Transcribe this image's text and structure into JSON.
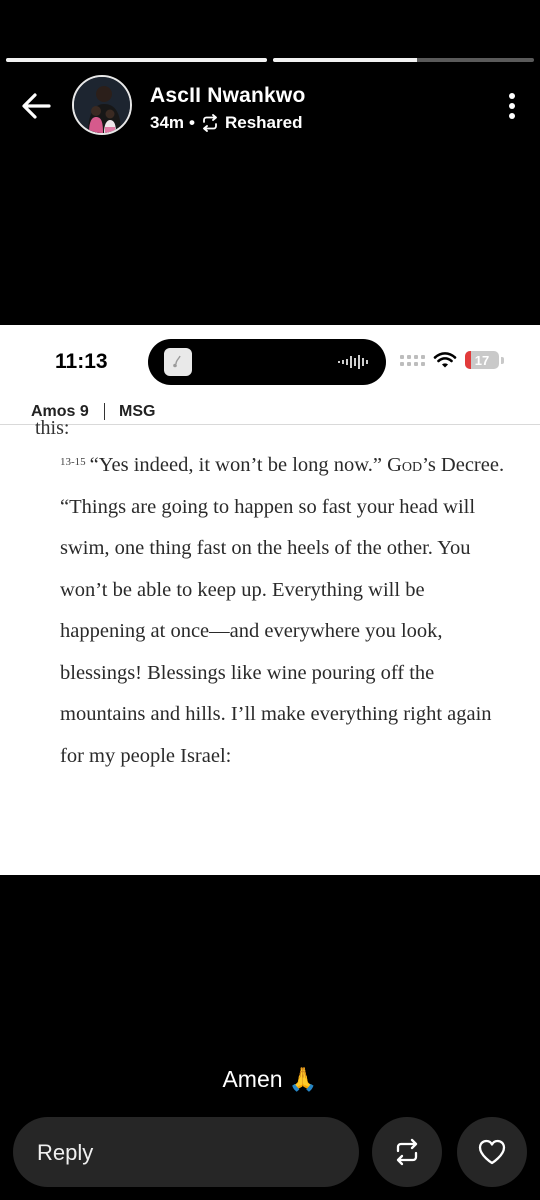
{
  "story": {
    "progress": [
      1.0,
      0.55
    ]
  },
  "header": {
    "author_name": "AscII Nwankwo",
    "time_ago": "34m",
    "dot": "•",
    "reshared_label": "Reshared",
    "back_icon": "arrow-left-icon",
    "more_icon": "more-vertical-icon",
    "reshare_icon": "repost-icon"
  },
  "screenshot": {
    "status_time": "11:13",
    "battery_level": "17",
    "battery_fraction": 0.17,
    "book": "Amos 9",
    "version": "MSG",
    "cut_line": "this:",
    "verse_number": "13-15",
    "line1": "“Yes indeed, it won’t be long now.” G",
    "line1_smallcaps": "od",
    "line1_end": "’s Decree.",
    "paragraph2": "“Things are going to happen so fast your head will swim, one thing fast on the heels of the other. You won’t be able to keep up. Everything will be happening at once—and everywhere you look, blessings! Blessings like wine pouring off the mountains and hills. I’ll make everything right again for my people Israel:"
  },
  "caption": {
    "text": "Amen 🙏"
  },
  "footer": {
    "reply_placeholder": "Reply",
    "repost_icon": "repost-icon",
    "like_icon": "heart-outline-icon"
  },
  "colors": {
    "background": "#000000",
    "card": "#ffffff",
    "control_bg": "#262626",
    "battery_low": "#e23b3b"
  }
}
